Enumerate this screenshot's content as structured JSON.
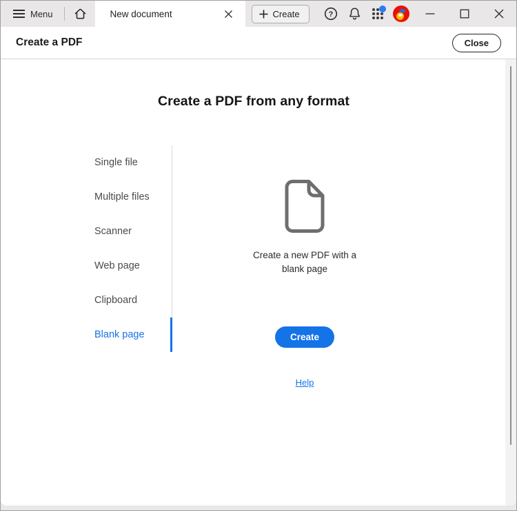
{
  "titlebar": {
    "menu_label": "Menu",
    "tab_title": "New document",
    "create_label": "Create",
    "icons": {
      "menu": "hamburger-icon",
      "home": "home-icon",
      "tab_close": "close-icon",
      "create": "plus-icon",
      "help": "question-circle-icon",
      "notifications": "bell-icon",
      "apps": "app-grid-icon",
      "brand": "acrobat-logo",
      "minimize": "minimize-icon",
      "maximize": "maximize-icon",
      "close": "close-icon"
    }
  },
  "header": {
    "title": "Create a PDF",
    "close_label": "Close"
  },
  "main": {
    "heading": "Create a PDF from any format",
    "nav": {
      "items": [
        {
          "label": "Single file",
          "selected": false
        },
        {
          "label": "Multiple files",
          "selected": false
        },
        {
          "label": "Scanner",
          "selected": false
        },
        {
          "label": "Web page",
          "selected": false
        },
        {
          "label": "Clipboard",
          "selected": false
        },
        {
          "label": "Blank page",
          "selected": true
        }
      ]
    },
    "detail": {
      "icon": "blank-document-icon",
      "caption": "Create a new PDF with a blank page",
      "create_label": "Create",
      "help_label": "Help"
    }
  },
  "colors": {
    "accent_blue": "#1473e6",
    "brand_red": "#eb1000",
    "badge_blue": "#2b7bf3",
    "chrome_gray": "#e9e7e7"
  }
}
